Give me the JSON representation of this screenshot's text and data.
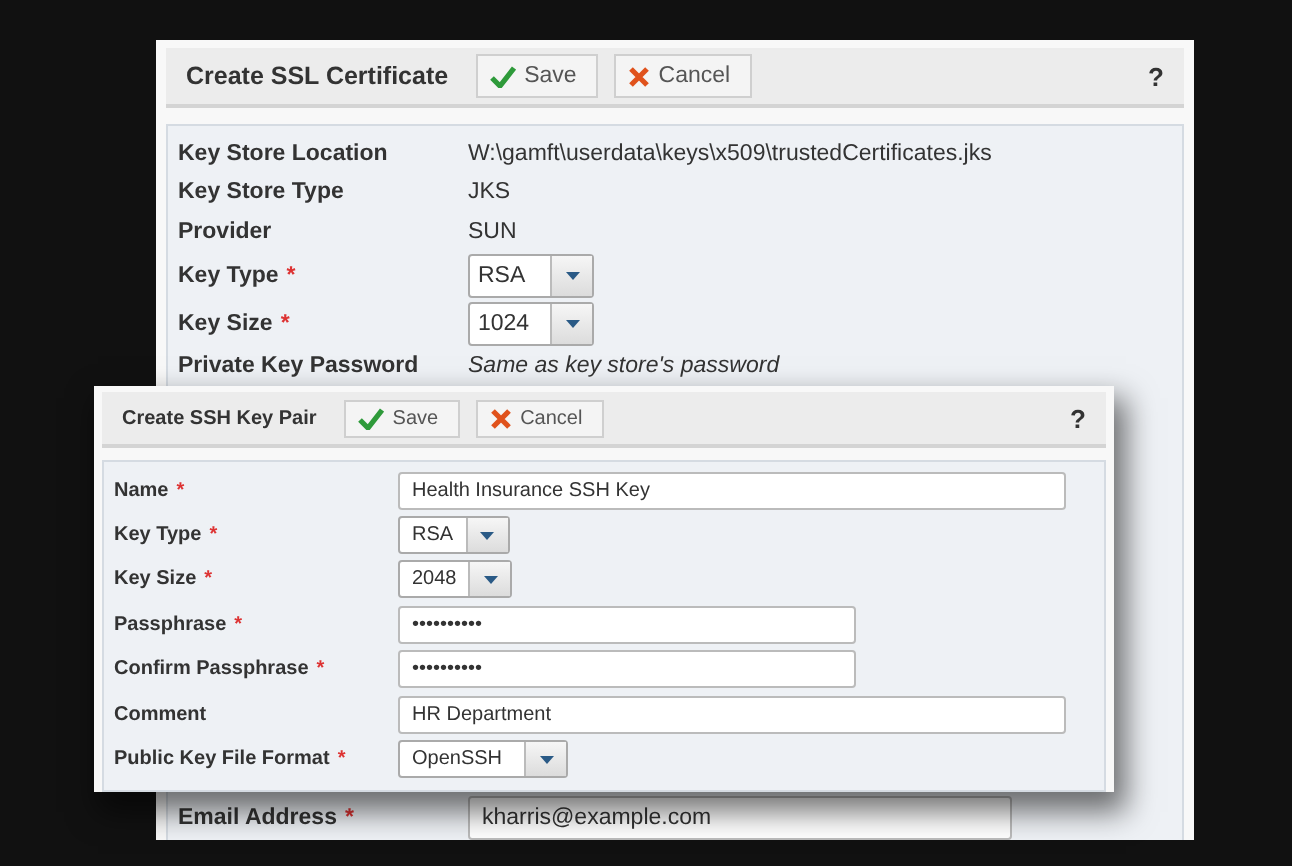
{
  "background_window": {
    "title": "Create SSL Certificate",
    "buttons": [
      {
        "label": "Save",
        "kind": "save"
      },
      {
        "label": "Cancel",
        "kind": "cancel"
      }
    ],
    "help": "?",
    "fields": [
      {
        "label": "Key Store Location",
        "kind": "static",
        "value": "W:\\gamft\\userdata\\keys\\x509\\trustedCertificates.jks"
      },
      {
        "label": "Key Store Type",
        "kind": "static",
        "value": "JKS"
      },
      {
        "label": "Provider",
        "kind": "static",
        "value": "SUN"
      },
      {
        "label": "Key Type",
        "required_mark": "*",
        "kind": "select",
        "value": "RSA"
      },
      {
        "label": "Key Size",
        "required_mark": "*",
        "kind": "select",
        "value": "1024"
      },
      {
        "label": "Private Key Password",
        "kind": "note",
        "value": "Same as key store's password"
      },
      {
        "label": "Email Address",
        "required_mark": "*",
        "kind": "text",
        "value": "kharris@example.com"
      }
    ]
  },
  "dialog": {
    "title": "Create SSH Key Pair",
    "buttons": [
      {
        "label": "Save",
        "kind": "save"
      },
      {
        "label": "Cancel",
        "kind": "cancel"
      }
    ],
    "help": "?",
    "fields": [
      {
        "label": "Name",
        "required_mark": "*",
        "kind": "text",
        "value": "Health Insurance SSH Key"
      },
      {
        "label": "Key Type",
        "required_mark": "*",
        "kind": "select",
        "value": "RSA"
      },
      {
        "label": "Key Size",
        "required_mark": "*",
        "kind": "select",
        "value": "2048"
      },
      {
        "label": "Passphrase",
        "required_mark": "*",
        "kind": "password",
        "value": "••••••••••"
      },
      {
        "label": "Confirm Passphrase",
        "required_mark": "*",
        "kind": "password",
        "value": "••••••••••"
      },
      {
        "label": "Comment",
        "kind": "text",
        "value": "HR Department"
      },
      {
        "label": "Public Key File Format",
        "required_mark": "*",
        "kind": "select",
        "value": "OpenSSH"
      }
    ]
  }
}
